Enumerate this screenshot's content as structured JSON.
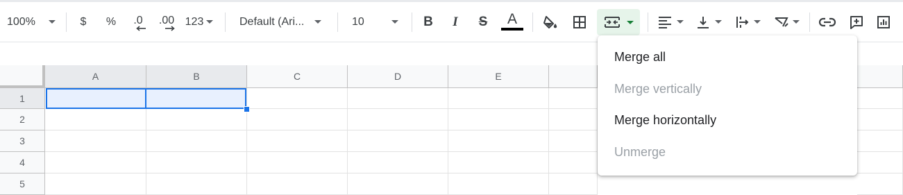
{
  "toolbar": {
    "zoom": "100%",
    "currency": "$",
    "percent": "%",
    "decrease_decimal": ".0",
    "increase_decimal": ".00",
    "more_formats": "123",
    "font_family": "Default (Ari...",
    "font_size": "10",
    "bold": "B",
    "italic": "I",
    "strikethrough": "S",
    "text_color_glyph": "A",
    "text_color": "#000000",
    "merge_active_color": "#e6f4ea",
    "merge_caret_color": "#188038"
  },
  "grid": {
    "columns": [
      "A",
      "B",
      "C",
      "D",
      "E"
    ],
    "rows": [
      "1",
      "2",
      "3",
      "4",
      "5"
    ]
  },
  "merge_menu": {
    "items": [
      {
        "label": "Merge all",
        "enabled": true
      },
      {
        "label": "Merge vertically",
        "enabled": false
      },
      {
        "label": "Merge horizontally",
        "enabled": true
      },
      {
        "label": "Unmerge",
        "enabled": false
      }
    ]
  },
  "colors": {
    "selection_border": "#1a73e8",
    "selection_fill": "#e8f0fe",
    "disabled_text": "#9aa0a6"
  }
}
